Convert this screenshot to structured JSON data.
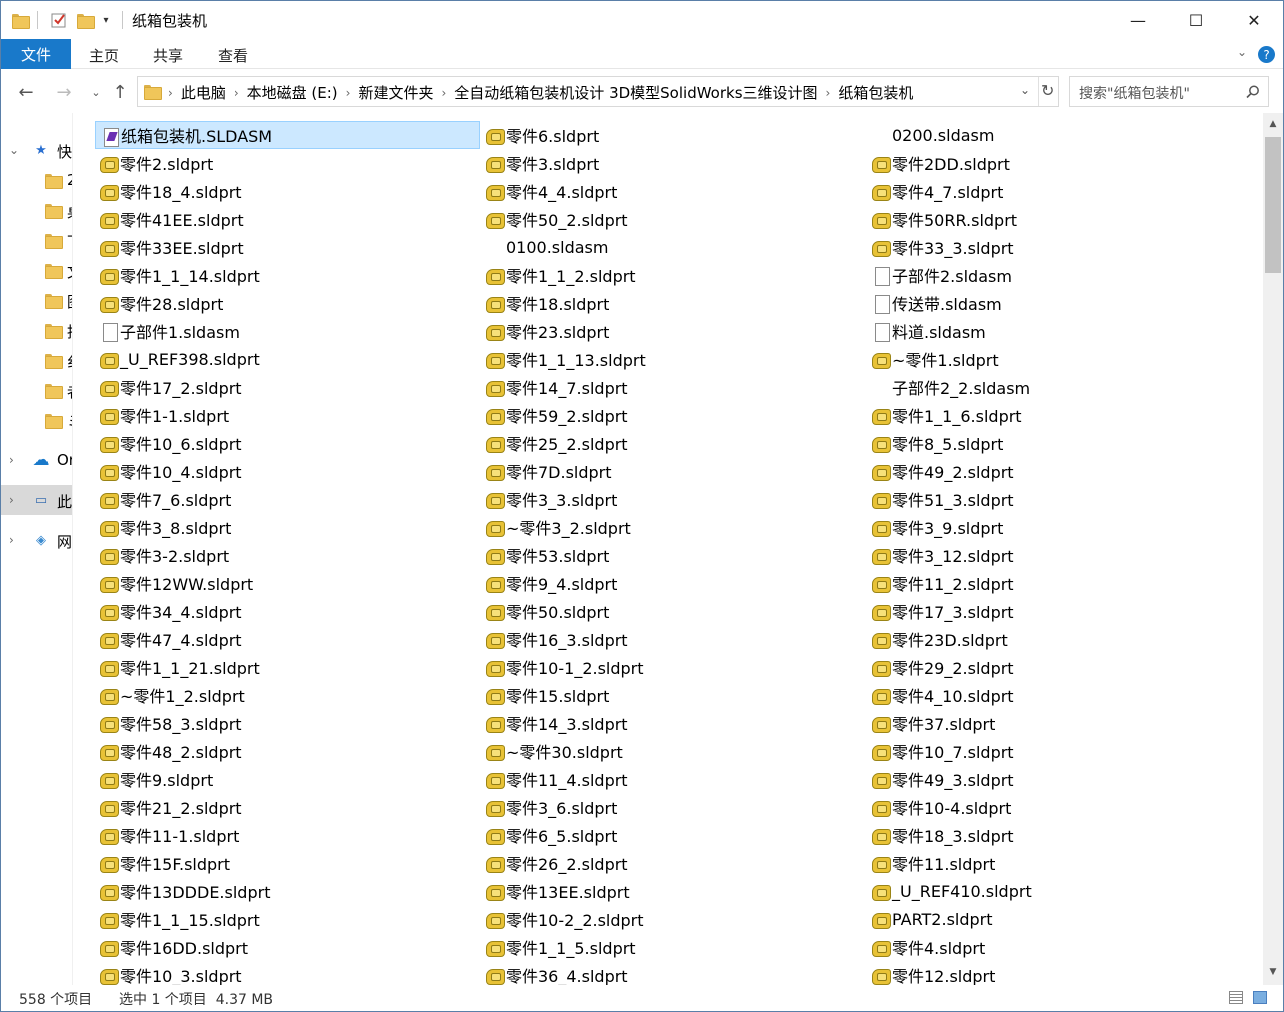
{
  "title": "纸箱包装机",
  "ribbon": {
    "tabs": [
      "文件",
      "主页",
      "共享",
      "查看"
    ]
  },
  "address": {
    "crumbs": [
      "此电脑",
      "本地磁盘 (E:)",
      "新建文件夹",
      "全自动纸箱包装机设计 3D模型SolidWorks三维设计图",
      "纸箱包装机"
    ]
  },
  "search": {
    "placeholder": "搜索\"纸箱包装机\""
  },
  "nav": [
    {
      "label": "快",
      "icon": "star-icon",
      "chevron": "⌄"
    },
    {
      "label": "2",
      "icon": "folder-icon"
    },
    {
      "label": "桌",
      "icon": "desktop-folder-icon"
    },
    {
      "label": "下",
      "icon": "download-folder-icon"
    },
    {
      "label": "文",
      "icon": "document-folder-icon"
    },
    {
      "label": "图",
      "icon": "picture-folder-icon"
    },
    {
      "label": "拍",
      "icon": "folder-icon"
    },
    {
      "label": "纟",
      "icon": "folder-icon"
    },
    {
      "label": "者",
      "icon": "folder-icon"
    },
    {
      "label": "ミ",
      "icon": "folder-icon"
    },
    {
      "label": "Or",
      "icon": "cloud-icon",
      "chevron": "›"
    },
    {
      "label": "此",
      "icon": "computer-icon",
      "chevron": "›"
    },
    {
      "label": "网",
      "icon": "network-icon",
      "chevron": "›"
    }
  ],
  "files": [
    [
      [
        "纸箱包装机.SLDASM",
        "asm"
      ],
      [
        "零件2.sldprt",
        "part"
      ],
      [
        "零件18_4.sldprt",
        "part"
      ],
      [
        "零件41EE.sldprt",
        "part"
      ],
      [
        "零件33EE.sldprt",
        "part"
      ],
      [
        "零件1_1_14.sldprt",
        "part"
      ],
      [
        "零件28.sldprt",
        "part"
      ],
      [
        "子部件1.sldasm",
        "doc"
      ],
      [
        "_U_REF398.sldprt",
        "part"
      ],
      [
        "零件17_2.sldprt",
        "part"
      ],
      [
        "零件1-1.sldprt",
        "part"
      ],
      [
        "零件10_6.sldprt",
        "part"
      ],
      [
        "零件10_4.sldprt",
        "part"
      ],
      [
        "零件7_6.sldprt",
        "part"
      ],
      [
        "零件3_8.sldprt",
        "part"
      ],
      [
        "零件3-2.sldprt",
        "part"
      ],
      [
        "零件12WW.sldprt",
        "part"
      ],
      [
        "零件34_4.sldprt",
        "part"
      ],
      [
        "零件47_4.sldprt",
        "part"
      ],
      [
        "零件1_1_21.sldprt",
        "part"
      ],
      [
        "~零件1_2.sldprt",
        "part"
      ],
      [
        "零件58_3.sldprt",
        "part"
      ],
      [
        "零件48_2.sldprt",
        "part"
      ],
      [
        "零件9.sldprt",
        "part"
      ],
      [
        "零件21_2.sldprt",
        "part"
      ],
      [
        "零件11-1.sldprt",
        "part"
      ],
      [
        "零件15F.sldprt",
        "part"
      ],
      [
        "零件13DDDE.sldprt",
        "part"
      ],
      [
        "零件1_1_15.sldprt",
        "part"
      ],
      [
        "零件16DD.sldprt",
        "part"
      ],
      [
        "零件10_3.sldprt",
        "part"
      ]
    ],
    [
      [
        "零件6.sldprt",
        "part"
      ],
      [
        "零件3.sldprt",
        "part"
      ],
      [
        "零件4_4.sldprt",
        "part"
      ],
      [
        "零件50_2.sldprt",
        "part"
      ],
      [
        "0100.sldasm",
        "none"
      ],
      [
        "零件1_1_2.sldprt",
        "part"
      ],
      [
        "零件18.sldprt",
        "part"
      ],
      [
        "零件23.sldprt",
        "part"
      ],
      [
        "零件1_1_13.sldprt",
        "part"
      ],
      [
        "零件14_7.sldprt",
        "part"
      ],
      [
        "零件59_2.sldprt",
        "part"
      ],
      [
        "零件25_2.sldprt",
        "part"
      ],
      [
        "零件7D.sldprt",
        "part"
      ],
      [
        "零件3_3.sldprt",
        "part"
      ],
      [
        "~零件3_2.sldprt",
        "part"
      ],
      [
        "零件53.sldprt",
        "part"
      ],
      [
        "零件9_4.sldprt",
        "part"
      ],
      [
        "零件50.sldprt",
        "part"
      ],
      [
        "零件16_3.sldprt",
        "part"
      ],
      [
        "零件10-1_2.sldprt",
        "part"
      ],
      [
        "零件15.sldprt",
        "part"
      ],
      [
        "零件14_3.sldprt",
        "part"
      ],
      [
        "~零件30.sldprt",
        "part"
      ],
      [
        "零件11_4.sldprt",
        "part"
      ],
      [
        "零件3_6.sldprt",
        "part"
      ],
      [
        "零件6_5.sldprt",
        "part"
      ],
      [
        "零件26_2.sldprt",
        "part"
      ],
      [
        "零件13EE.sldprt",
        "part"
      ],
      [
        "零件10-2_2.sldprt",
        "part"
      ],
      [
        "零件1_1_5.sldprt",
        "part"
      ],
      [
        "零件36_4.sldprt",
        "part"
      ]
    ],
    [
      [
        "0200.sldasm",
        "none"
      ],
      [
        "零件2DD.sldprt",
        "part"
      ],
      [
        "零件4_7.sldprt",
        "part"
      ],
      [
        "零件50RR.sldprt",
        "part"
      ],
      [
        "零件33_3.sldprt",
        "part"
      ],
      [
        "子部件2.sldasm",
        "doc"
      ],
      [
        "传送带.sldasm",
        "doc"
      ],
      [
        "料道.sldasm",
        "doc"
      ],
      [
        "~零件1.sldprt",
        "part"
      ],
      [
        "子部件2_2.sldasm",
        "none"
      ],
      [
        "零件1_1_6.sldprt",
        "part"
      ],
      [
        "零件8_5.sldprt",
        "part"
      ],
      [
        "零件49_2.sldprt",
        "part"
      ],
      [
        "零件51_3.sldprt",
        "part"
      ],
      [
        "零件3_9.sldprt",
        "part"
      ],
      [
        "零件3_12.sldprt",
        "part"
      ],
      [
        "零件11_2.sldprt",
        "part"
      ],
      [
        "零件17_3.sldprt",
        "part"
      ],
      [
        "零件23D.sldprt",
        "part"
      ],
      [
        "零件29_2.sldprt",
        "part"
      ],
      [
        "零件4_10.sldprt",
        "part"
      ],
      [
        "零件37.sldprt",
        "part"
      ],
      [
        "零件10_7.sldprt",
        "part"
      ],
      [
        "零件49_3.sldprt",
        "part"
      ],
      [
        "零件10-4.sldprt",
        "part"
      ],
      [
        "零件18_3.sldprt",
        "part"
      ],
      [
        "零件11.sldprt",
        "part"
      ],
      [
        "_U_REF410.sldprt",
        "part"
      ],
      [
        "PART2.sldprt",
        "part"
      ],
      [
        "零件4.sldprt",
        "part"
      ],
      [
        "零件12.sldprt",
        "part"
      ]
    ]
  ],
  "status": {
    "count": "558 个项目",
    "selection": "选中 1 个项目  4.37 MB"
  },
  "colors": {
    "accent": "#1979ca",
    "selection": "#cce8ff",
    "selection_border": "#99d1ff"
  }
}
